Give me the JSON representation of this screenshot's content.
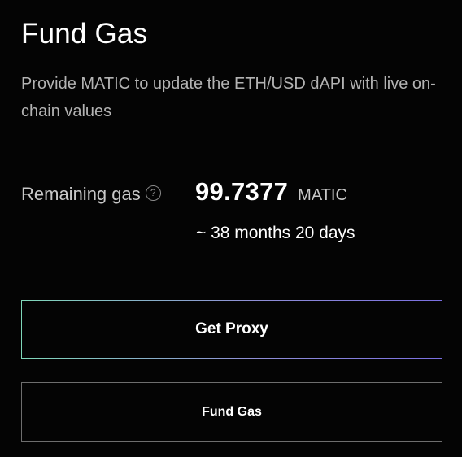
{
  "header": {
    "title": "Fund Gas",
    "description": "Provide MATIC to update the ETH/USD dAPI with live on-chain values"
  },
  "gas": {
    "label": "Remaining gas",
    "help_icon_glyph": "?",
    "amount": "99.7377",
    "unit": "MATIC",
    "duration": "~ 38 months 20 days"
  },
  "actions": {
    "get_proxy_label": "Get Proxy",
    "fund_gas_label": "Fund Gas"
  },
  "icons": {
    "help": "question-circle-icon"
  },
  "colors": {
    "background": "#040404",
    "accent_gradient_start": "#7fd7b9",
    "accent_gradient_end": "#7a6fe0"
  }
}
